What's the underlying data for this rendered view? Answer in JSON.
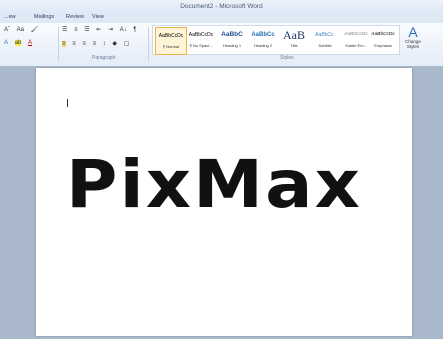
{
  "window": {
    "title": "Document2 - Microsoft Word"
  },
  "tabs": [
    "...ew",
    "Mailings",
    "Review",
    "View"
  ],
  "ribbon": {
    "font_row1": [
      "Aˆ",
      "Aa",
      "🖌"
    ],
    "para_row1": [
      "☰",
      "≡",
      "☰",
      "⇤",
      "⇥",
      "A↓",
      "¶"
    ],
    "groups": {
      "paragraph": "Paragraph",
      "styles": "Styles"
    },
    "styles": [
      {
        "preview": "AaBbCcDc",
        "label": "¶ Normal"
      },
      {
        "preview": "AaBbCcDc",
        "label": "¶ No Spaci..."
      },
      {
        "preview": "AaBbC",
        "label": "Heading 1"
      },
      {
        "preview": "AaBbCc",
        "label": "Heading 2"
      },
      {
        "preview": "AaB",
        "label": "Title"
      },
      {
        "preview": "AaBbCc.",
        "label": "Subtitle"
      },
      {
        "preview": "AaBbCcDc",
        "label": "Subtle Em..."
      },
      {
        "preview": "AaBbCcDc",
        "label": "Emphasis"
      }
    ],
    "change_styles": {
      "icon": "A",
      "label": "Change Styles"
    }
  },
  "document": {
    "logo_text": "PixMax"
  }
}
